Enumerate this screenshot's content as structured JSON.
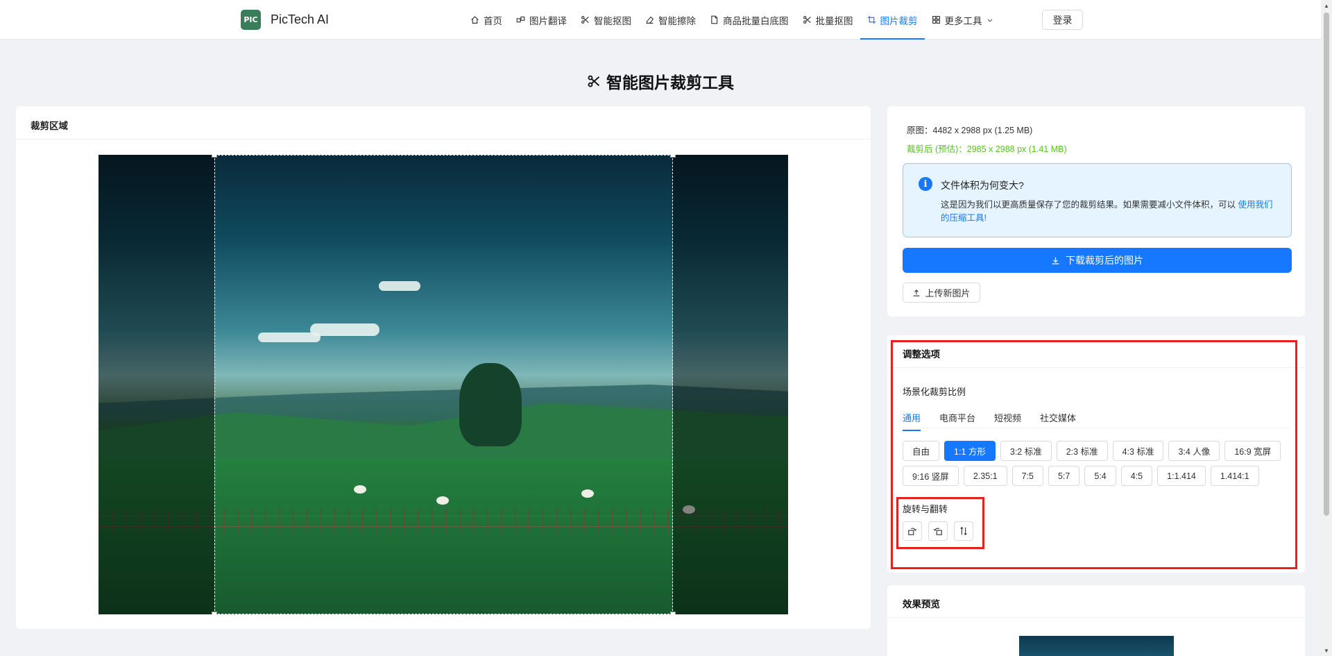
{
  "brand": {
    "logo_text": "PIC",
    "name": "PicTech AI"
  },
  "nav": {
    "items": [
      {
        "label": "首页",
        "icon": "home-icon"
      },
      {
        "label": "图片翻译",
        "icon": "translate-icon"
      },
      {
        "label": "智能抠图",
        "icon": "scissors-icon"
      },
      {
        "label": "智能擦除",
        "icon": "eraser-icon"
      },
      {
        "label": "商品批量白底图",
        "icon": "document-icon"
      },
      {
        "label": "批量抠图",
        "icon": "scissors-icon"
      },
      {
        "label": "图片裁剪",
        "icon": "crop-icon"
      },
      {
        "label": "更多工具",
        "icon": "grid-icon"
      }
    ],
    "active_index": 6,
    "login_label": "登录"
  },
  "page": {
    "title": "智能图片裁剪工具"
  },
  "crop_area": {
    "title": "裁剪区域"
  },
  "info": {
    "original": "原图：4482 x 2988 px (1.25 MB)",
    "cropped": "裁剪后 (预估)：2985 x 2988 px (1.41 MB)",
    "alert_title": "文件体积为何变大?",
    "alert_body": "这是因为我们以更高质量保存了您的裁剪结果。如果需要减小文件体积，可以 ",
    "alert_link": "使用我们的压缩工具!",
    "download_label": "下载裁剪后的图片",
    "upload_label": "上传新图片"
  },
  "adjust": {
    "title": "调整选项",
    "ratio_section_label": "场景化裁剪比例",
    "tabs": [
      "通用",
      "电商平台",
      "短视频",
      "社交媒体"
    ],
    "active_tab": 0,
    "ratios_row1": [
      "自由",
      "1:1 方形",
      "3:2 标准",
      "2:3 标准",
      "4:3 标准",
      "3:4 人像",
      "16:9 宽屏"
    ],
    "ratios_row2": [
      "9:16 竖屏",
      "2.35:1",
      "7:5",
      "5:7",
      "5:4",
      "4:5",
      "1:1.414",
      "1.414:1"
    ],
    "active_ratio": "1:1 方形",
    "rotate_section_label": "旋转与翻转",
    "rotate_buttons": [
      "rotate-left-icon",
      "rotate-right-icon",
      "flip-vertical-icon"
    ]
  },
  "preview": {
    "title": "效果预览"
  },
  "colors": {
    "accent": "#1677ff",
    "highlight": "#e8201d",
    "success": "#52c41a"
  }
}
